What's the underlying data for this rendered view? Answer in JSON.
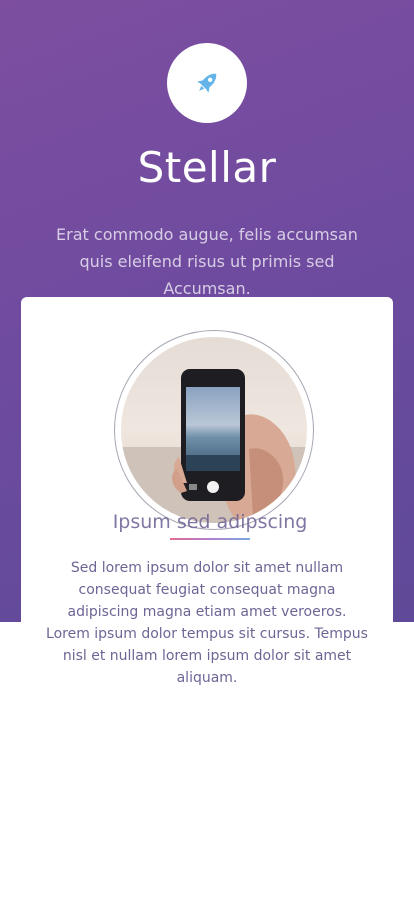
{
  "header": {
    "logo_icon": "rocket-icon",
    "title": "Stellar",
    "subtitle": "Erat commodo augue, felis accumsan quis eleifend risus ut primis sed Accumsan."
  },
  "feature": {
    "image_icon": "phone-photo",
    "title": "Ipsum sed adipscing",
    "text": "Sed lorem ipsum dolor sit amet nullam consequat feugiat consequat magna adipiscing magna etiam amet veroeros. Lorem ipsum dolor tempus sit cursus. Tempus nisl et nullam lorem ipsum dolor sit amet aliquam."
  },
  "colors": {
    "hero_background": "#6f4b9f",
    "accent_rocket": "#63b4e8",
    "text_primary": "#6f6595"
  }
}
